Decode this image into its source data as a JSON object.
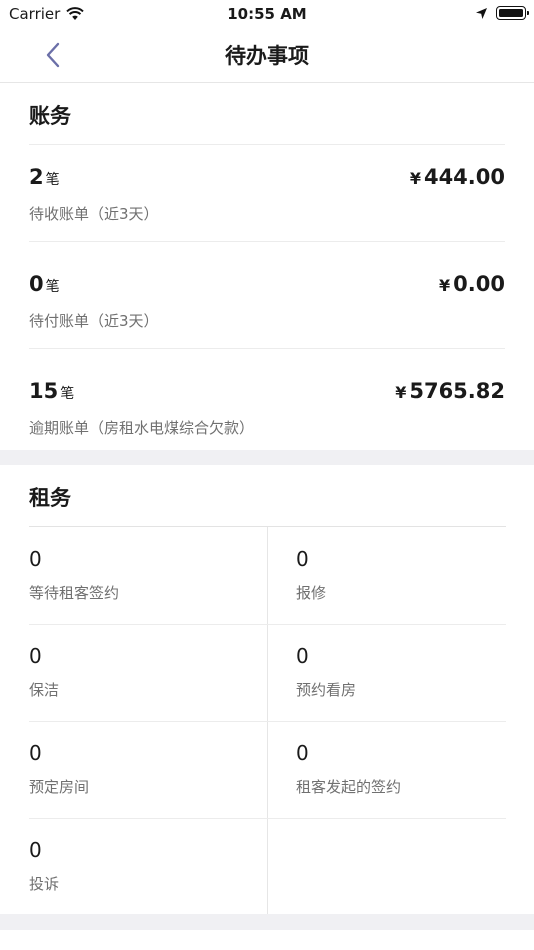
{
  "status_bar": {
    "carrier": "Carrier",
    "time": "10:55 AM"
  },
  "nav": {
    "title": "待办事项"
  },
  "finance": {
    "title": "账务",
    "rows": [
      {
        "count": "2",
        "unit": "笔",
        "currency": "¥",
        "amount": "444.00",
        "desc": "待收账单（近3天）"
      },
      {
        "count": "0",
        "unit": "笔",
        "currency": "¥",
        "amount": "0.00",
        "desc": "待付账单（近3天）"
      },
      {
        "count": "15",
        "unit": "笔",
        "currency": "¥",
        "amount": "5765.82",
        "desc": "逾期账单（房租水电煤综合欠款）"
      }
    ]
  },
  "rental": {
    "title": "租务",
    "items": [
      {
        "value": "0",
        "label": "等待租客签约"
      },
      {
        "value": "0",
        "label": "报修"
      },
      {
        "value": "0",
        "label": "保洁"
      },
      {
        "value": "0",
        "label": "预约看房"
      },
      {
        "value": "0",
        "label": "预定房间"
      },
      {
        "value": "0",
        "label": "租客发起的签约"
      },
      {
        "value": "0",
        "label": "投诉"
      }
    ]
  },
  "colors": {
    "section_gap": "#f0f0f3",
    "back_arrow": "#6b6fa8",
    "secondary_text": "#707070"
  }
}
